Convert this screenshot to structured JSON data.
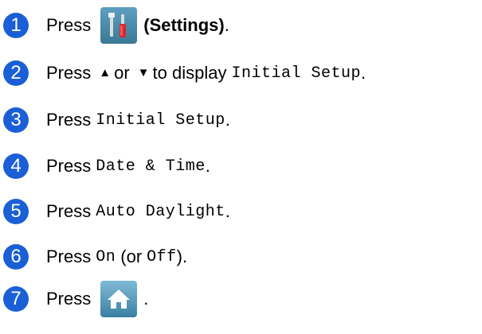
{
  "colors": {
    "step_circle": "#1a5fd6",
    "settings_icon_bg": "#4a8aaa",
    "home_icon_bg": "#5b9dbd"
  },
  "icons": [
    "settings-icon",
    "home-icon",
    "triangle-up-icon",
    "triangle-down-icon"
  ],
  "steps": [
    {
      "num": "1",
      "press": "Press",
      "settings_label": "(Settings)",
      "end": "."
    },
    {
      "num": "2",
      "press": "Press",
      "up": "▲",
      "or": "or",
      "down": "▼",
      "mid": "to display",
      "target": "Initial Setup",
      "end": "."
    },
    {
      "num": "3",
      "press": "Press",
      "target": "Initial Setup",
      "end": "."
    },
    {
      "num": "4",
      "press": "Press",
      "target": "Date & Time",
      "end": "."
    },
    {
      "num": "5",
      "press": "Press",
      "target": "Auto Daylight",
      "end": "."
    },
    {
      "num": "6",
      "press": "Press",
      "target": "On",
      "open": "(or",
      "alt": "Off",
      "end": ")."
    },
    {
      "num": "7",
      "press": "Press",
      "end": "."
    }
  ]
}
